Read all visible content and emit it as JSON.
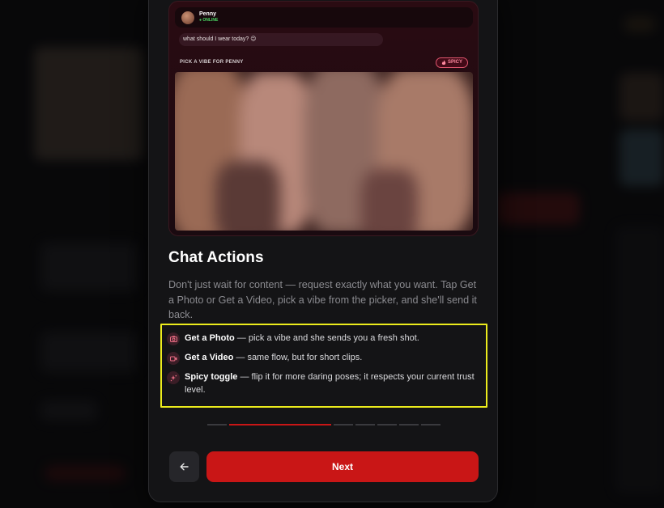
{
  "preview": {
    "chat_name": "Penny",
    "chat_status": "● ONLINE",
    "chat_message": "what should I wear today? 😉",
    "picker_title": "PICK A VIBE FOR PENNY",
    "spicy_chip": "SPICY"
  },
  "content": {
    "title": "Chat Actions",
    "description": "Don't just wait for content — request exactly what you want. Tap Get a Photo or Get a Video, pick a vibe from the picker, and she'll send it back."
  },
  "features": [
    {
      "icon": "camera-icon",
      "label": "Get a Photo",
      "text": " — pick a vibe and she sends you a fresh shot."
    },
    {
      "icon": "video-icon",
      "label": "Get a Video",
      "text": " — same flow, but for short clips."
    },
    {
      "icon": "sparkles-icon",
      "label": "Spicy toggle",
      "text": " — flip it for more daring poses; it respects your current trust level."
    }
  ],
  "pager": {
    "total": 7,
    "current": 2
  },
  "footer": {
    "back_icon": "arrow-left-icon",
    "next_label": "Next"
  },
  "colors": {
    "accent": "#c91616",
    "highlight": "#ecec1c",
    "modal_bg": "#141416",
    "online": "#4cd964"
  }
}
